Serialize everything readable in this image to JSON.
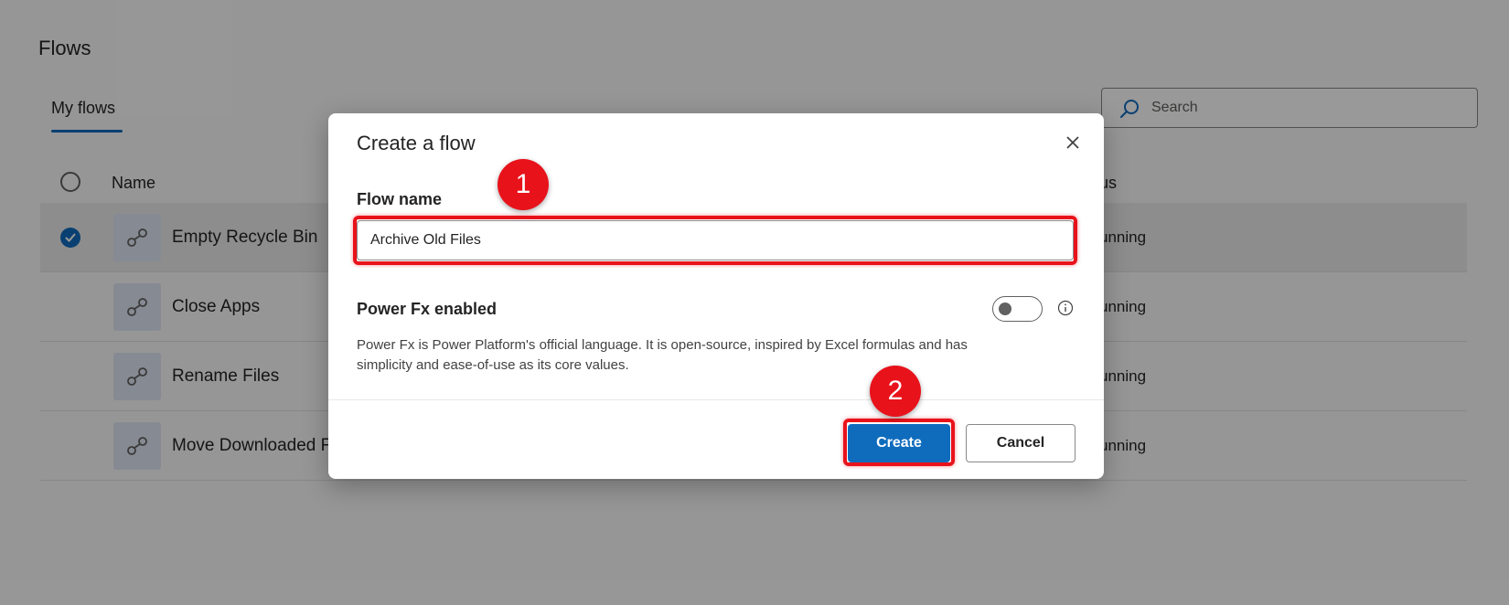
{
  "page": {
    "title": "Flows",
    "tab_label": "My flows",
    "search_placeholder": "Search"
  },
  "table": {
    "col_name": "Name",
    "col_status": "us",
    "rows": [
      {
        "name": "Empty Recycle Bin",
        "status": "unning",
        "selected": true
      },
      {
        "name": "Close Apps",
        "status": "unning",
        "selected": false
      },
      {
        "name": "Rename Files",
        "status": "unning",
        "selected": false
      },
      {
        "name": "Move Downloaded F",
        "status": "unning",
        "selected": false
      }
    ]
  },
  "dialog": {
    "title": "Create a flow",
    "flow_name_label": "Flow name",
    "flow_name_value": "Archive Old Files",
    "power_fx_label": "Power Fx enabled",
    "power_fx_enabled": false,
    "power_fx_description": "Power Fx is Power Platform's official language. It is open-source, inspired by Excel formulas and has simplicity and ease-of-use as its core values.",
    "create_label": "Create",
    "cancel_label": "Cancel"
  },
  "annotations": {
    "step1": "1",
    "step2": "2"
  },
  "colors": {
    "accent": "#0f6cbd",
    "highlight": "#e8121b"
  }
}
